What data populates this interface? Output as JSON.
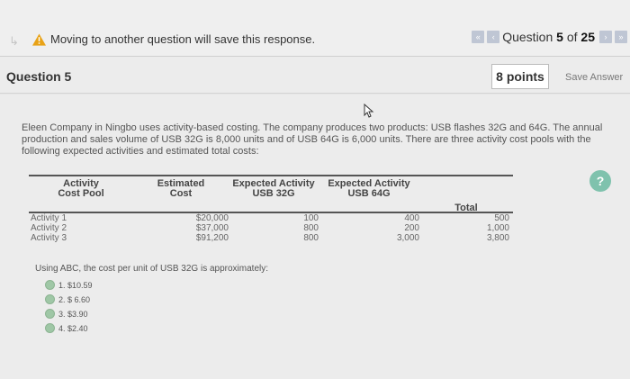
{
  "top_bar": {
    "warning": "Moving to another question will save this response.",
    "question_label": "Question",
    "question_number": "5",
    "of_label": "of",
    "question_total": "25"
  },
  "question": {
    "title": "Question 5",
    "points": "8 points",
    "save_label": "Save Answer",
    "intro": "Eleen Company in Ningbo uses activity-based costing. The company produces two products: USB flashes 32G and 64G. The annual production and sales volume of USB 32G is 8,000 units and of USB 64G is 6,000 units. There are three activity cost pools with the following expected activities and estimated total costs:",
    "help_label": "?"
  },
  "table": {
    "headers": {
      "activity": "Activity Cost Pool",
      "cost": "Estimated Cost",
      "usb32": "Expected Activity USB 32G",
      "usb64": "Expected Activity USB 64G",
      "total": "Total"
    },
    "rows": [
      {
        "name": "Activity 1",
        "cost": "$20,000",
        "usb32": "100",
        "usb64": "400",
        "total": "500"
      },
      {
        "name": "Activity 2",
        "cost": "$37,000",
        "usb32": "800",
        "usb64": "200",
        "total": "1,000"
      },
      {
        "name": "Activity 3",
        "cost": "$91,200",
        "usb32": "800",
        "usb64": "3,000",
        "total": "3,800"
      }
    ]
  },
  "prompt": "Using ABC, the cost per unit of USB 32G is approximately:",
  "options": [
    "1. $10.59",
    "2. $ 6.60",
    "3. $3.90",
    "4. $2.40"
  ],
  "colors": {
    "radio": "#9fc7a6",
    "help": "#7fc2ad",
    "nav": "#bfc6d4"
  }
}
